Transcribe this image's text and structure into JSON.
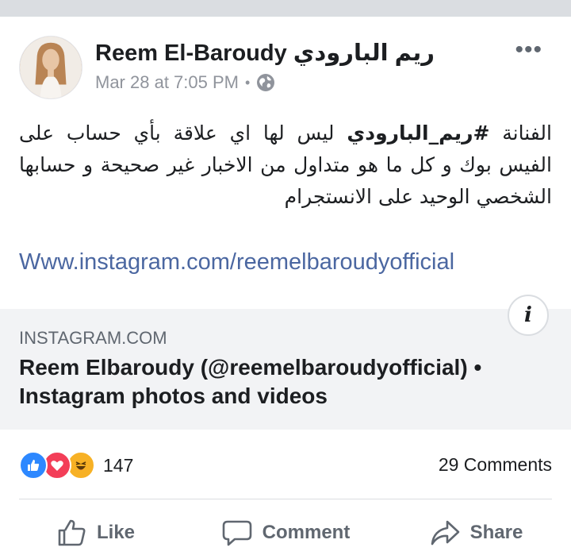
{
  "post": {
    "author": "Reem El-Baroudy ريم البارودي",
    "timestamp": "Mar 28 at 7:05 PM",
    "separator": "•",
    "privacy_icon": "globe-icon",
    "more_icon": "•••",
    "text_prefix": "الفنانة ",
    "hashtag": "#ريم_البارودي",
    "text_body": " ليس لها اي علاقة بأي حساب على الفيس بوك و كل ما هو متداول من الاخبار غير صحيحة و حسابها الشخصي الوحيد على الانستجرام",
    "link": "Www.instagram.com/reemelbaroudyofficial"
  },
  "preview": {
    "info_icon": "i",
    "domain": "INSTAGRAM.COM",
    "title": "Reem Elbaroudy (@reemelbaroudyofficial) • Instagram photos and videos"
  },
  "engagement": {
    "reaction_icons": [
      "like-icon",
      "love-icon",
      "haha-icon"
    ],
    "reaction_count": "147",
    "comments": "29 Comments"
  },
  "actions": {
    "like": "Like",
    "comment": "Comment",
    "share": "Share"
  },
  "colors": {
    "link": "#4b67a1",
    "preview_bg": "#f2f3f5",
    "muted": "#90949c",
    "like_blue": "#2d88ff",
    "love_red": "#f33e58",
    "haha_yellow": "#f7b125"
  }
}
